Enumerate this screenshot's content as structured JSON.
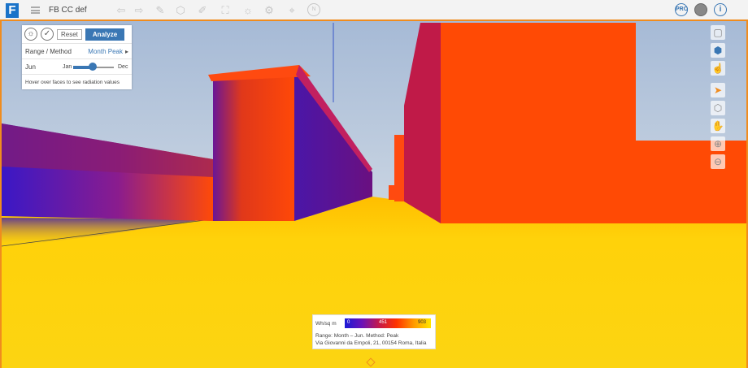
{
  "app": {
    "logo_letter": "F",
    "title": "FB  CC def"
  },
  "toolbar": {
    "tools": [
      "undo-icon",
      "redo-icon",
      "draw-icon",
      "box-icon",
      "paint-icon",
      "capture-icon",
      "sun-icon",
      "gear-icon",
      "location-icon",
      "help-icon"
    ],
    "right": {
      "pro_label": "PRO",
      "user_icon": "user-icon",
      "info_label": "i"
    }
  },
  "panel": {
    "reset_label": "Reset",
    "analyze_label": "Analyze",
    "range_label": "Range / Method",
    "range_value": "Month Peak",
    "month_label": "Jun",
    "slider_start": "Jan",
    "slider_end": "Dec",
    "slider_fraction": 0.42,
    "hint": "Hover over faces to see radiation values"
  },
  "right_tools": [
    "window-icon",
    "cube-icon",
    "hand-pointer-icon",
    "cursor-icon",
    "building-icon",
    "hand-icon",
    "zoom-in-icon",
    "zoom-out-icon"
  ],
  "legend": {
    "unit": "Wh/sq m",
    "min": "0",
    "mid": "451",
    "max": "903",
    "range_line": "Range:  Month – Jun.  Method:  Peak",
    "address": "Via Giovanni da Empoli, 21, 00154 Roma, Italia"
  },
  "colors": {
    "accent": "#f08c1e",
    "analyze": "#3a77b4",
    "logo": "#1a73c9"
  }
}
